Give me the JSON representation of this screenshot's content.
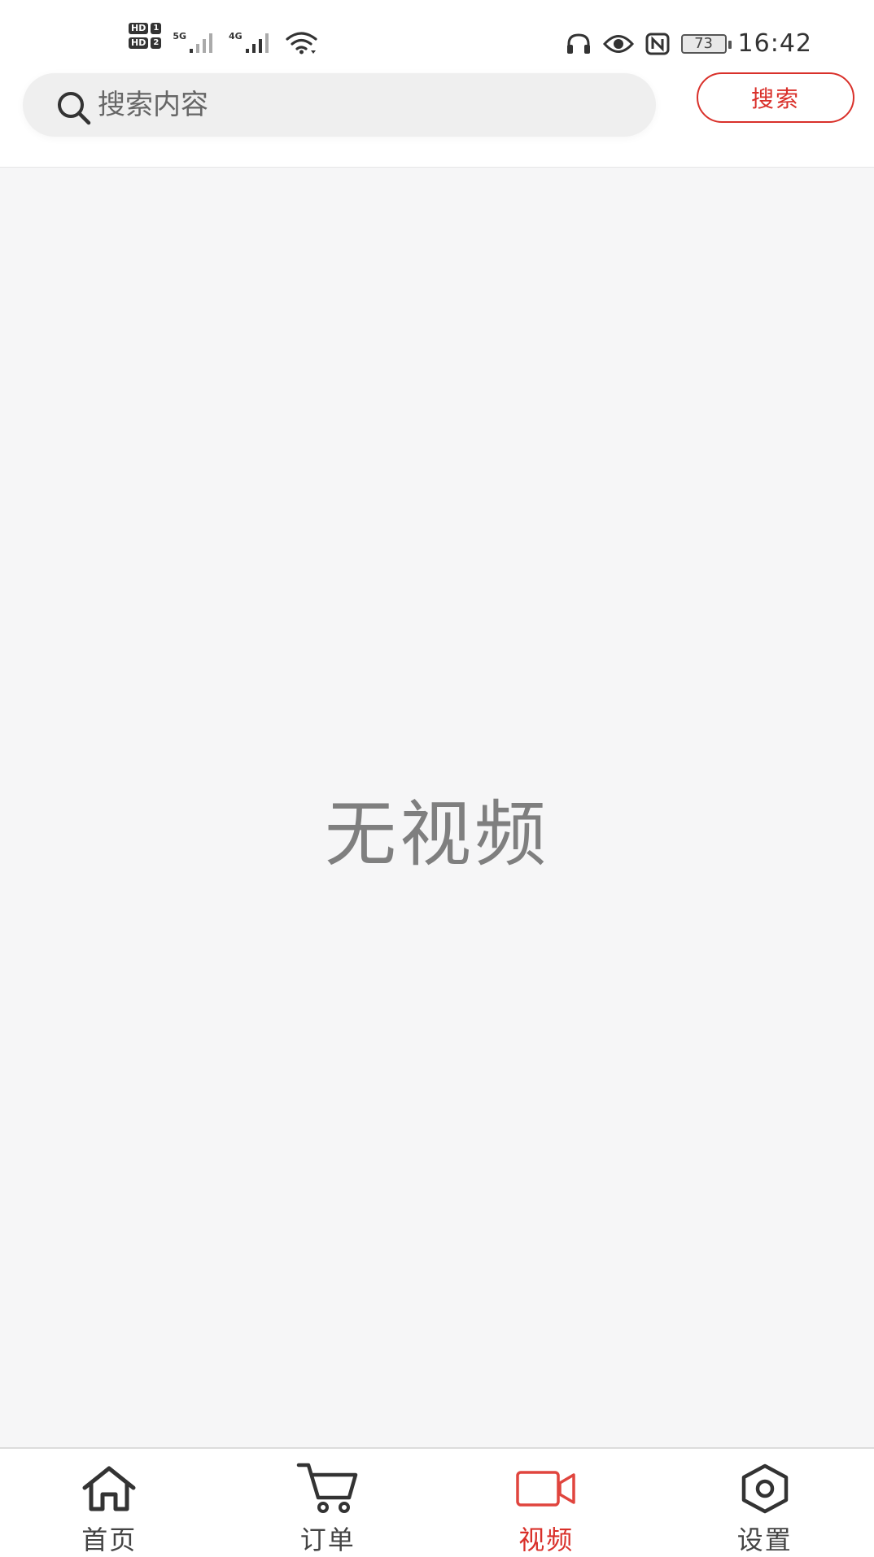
{
  "status_bar": {
    "hd1_label": "HD",
    "hd1_num": "1",
    "hd2_label": "HD",
    "hd2_num": "2",
    "net1": "5G",
    "net2": "4G",
    "battery": "73",
    "time": "16:42"
  },
  "search": {
    "placeholder": "搜索内容",
    "button_label": "搜索"
  },
  "content": {
    "empty_message": "无视频"
  },
  "tabs": [
    {
      "label": "首页",
      "icon": "home-icon",
      "active": false
    },
    {
      "label": "订单",
      "icon": "cart-icon",
      "active": false
    },
    {
      "label": "视频",
      "icon": "video-icon",
      "active": true
    },
    {
      "label": "设置",
      "icon": "settings-icon",
      "active": false
    }
  ],
  "colors": {
    "accent": "#d9302a",
    "background": "#f6f6f7",
    "muted_text": "#7f7f7f"
  }
}
